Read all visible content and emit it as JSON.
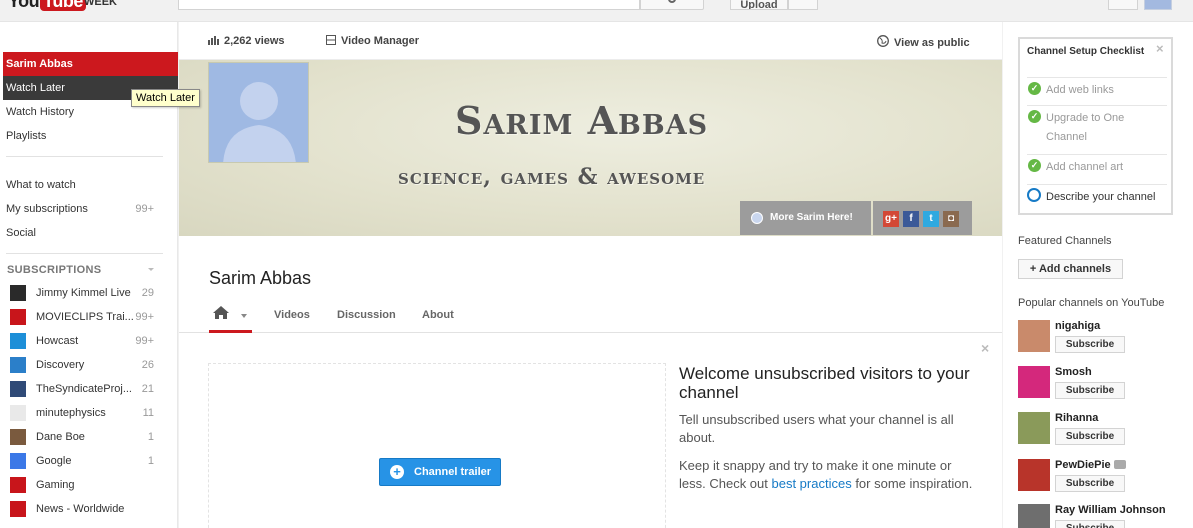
{
  "header": {
    "logo_you": "You",
    "logo_tube": "Tube",
    "logo_tag": "WEEK",
    "upload_label": "Upload"
  },
  "guide": {
    "top_items": [
      {
        "label": "Sarim Abbas"
      },
      {
        "label": "Watch Later"
      },
      {
        "label": "Watch History"
      },
      {
        "label": "Playlists"
      }
    ],
    "mid_items": [
      {
        "label": "What to watch",
        "count": ""
      },
      {
        "label": "My subscriptions",
        "count": "99+"
      },
      {
        "label": "Social",
        "count": ""
      }
    ],
    "subscriptions_heading": "SUBSCRIPTIONS",
    "subscriptions": [
      {
        "name": "Jimmy Kimmel Live",
        "count": "29",
        "color": "#2a2a2a"
      },
      {
        "name": "MOVIECLIPS Trai...",
        "count": "99+",
        "color": "#c8151b"
      },
      {
        "name": "Howcast",
        "count": "99+",
        "color": "#1d8fd8"
      },
      {
        "name": "Discovery",
        "count": "26",
        "color": "#2b7fc9"
      },
      {
        "name": "TheSyndicateProj...",
        "count": "21",
        "color": "#2f4a77"
      },
      {
        "name": "minutephysics",
        "count": "11",
        "color": "#e9e9e9"
      },
      {
        "name": "Dane Boe",
        "count": "1",
        "color": "#7a5a3e"
      },
      {
        "name": "Google",
        "count": "1",
        "color": "#3b78e7"
      },
      {
        "name": "Gaming",
        "count": "",
        "color": "#c8151b"
      },
      {
        "name": "News - Worldwide",
        "count": "",
        "color": "#c8151b"
      }
    ],
    "tooltip": "Watch Later"
  },
  "main": {
    "views": "2,262 views",
    "video_manager": "Video Manager",
    "view_as_public": "View as public",
    "banner_title": "Sarim Abbas",
    "banner_subtitle": "science, games & awesome",
    "banner_link": "More Sarim Here!",
    "channel_name": "Sarim Abbas",
    "tabs": [
      "Videos",
      "Discussion",
      "About"
    ],
    "trailer_button": "Channel trailer",
    "welcome_title": "Welcome unsubscribed visitors to your channel",
    "welcome_p1": "Tell unsubscribed users what your channel is all about.",
    "welcome_p2_a": "Keep it snappy and try to make it one minute or less. Check out ",
    "welcome_p2_link": "best practices",
    "welcome_p2_b": " for some inspiration."
  },
  "right": {
    "checklist_title": "Channel Setup Checklist",
    "checklist": [
      {
        "label": "Add web links",
        "done": true
      },
      {
        "label": "Upgrade to One Channel",
        "done": true
      },
      {
        "label": "Add channel art",
        "done": true
      },
      {
        "label": "Describe your channel",
        "done": false
      }
    ],
    "featured_heading": "Featured Channels",
    "add_channels": "+ Add channels",
    "popular_heading": "Popular channels on YouTube",
    "subscribe_label": "Subscribe",
    "popular": [
      {
        "name": "nigahiga",
        "color": "#c98a6b"
      },
      {
        "name": "Smosh",
        "color": "#d4287c"
      },
      {
        "name": "Rihanna",
        "color": "#8a9a5a"
      },
      {
        "name": "PewDiePie",
        "color": "#b8342a"
      },
      {
        "name": "Ray William Johnson",
        "color": "#6e6e6e"
      }
    ]
  },
  "colors": {
    "accent_red": "#cc181e",
    "link_blue": "#167ac6",
    "button_blue": "#2793e6",
    "check_green": "#65b845"
  }
}
